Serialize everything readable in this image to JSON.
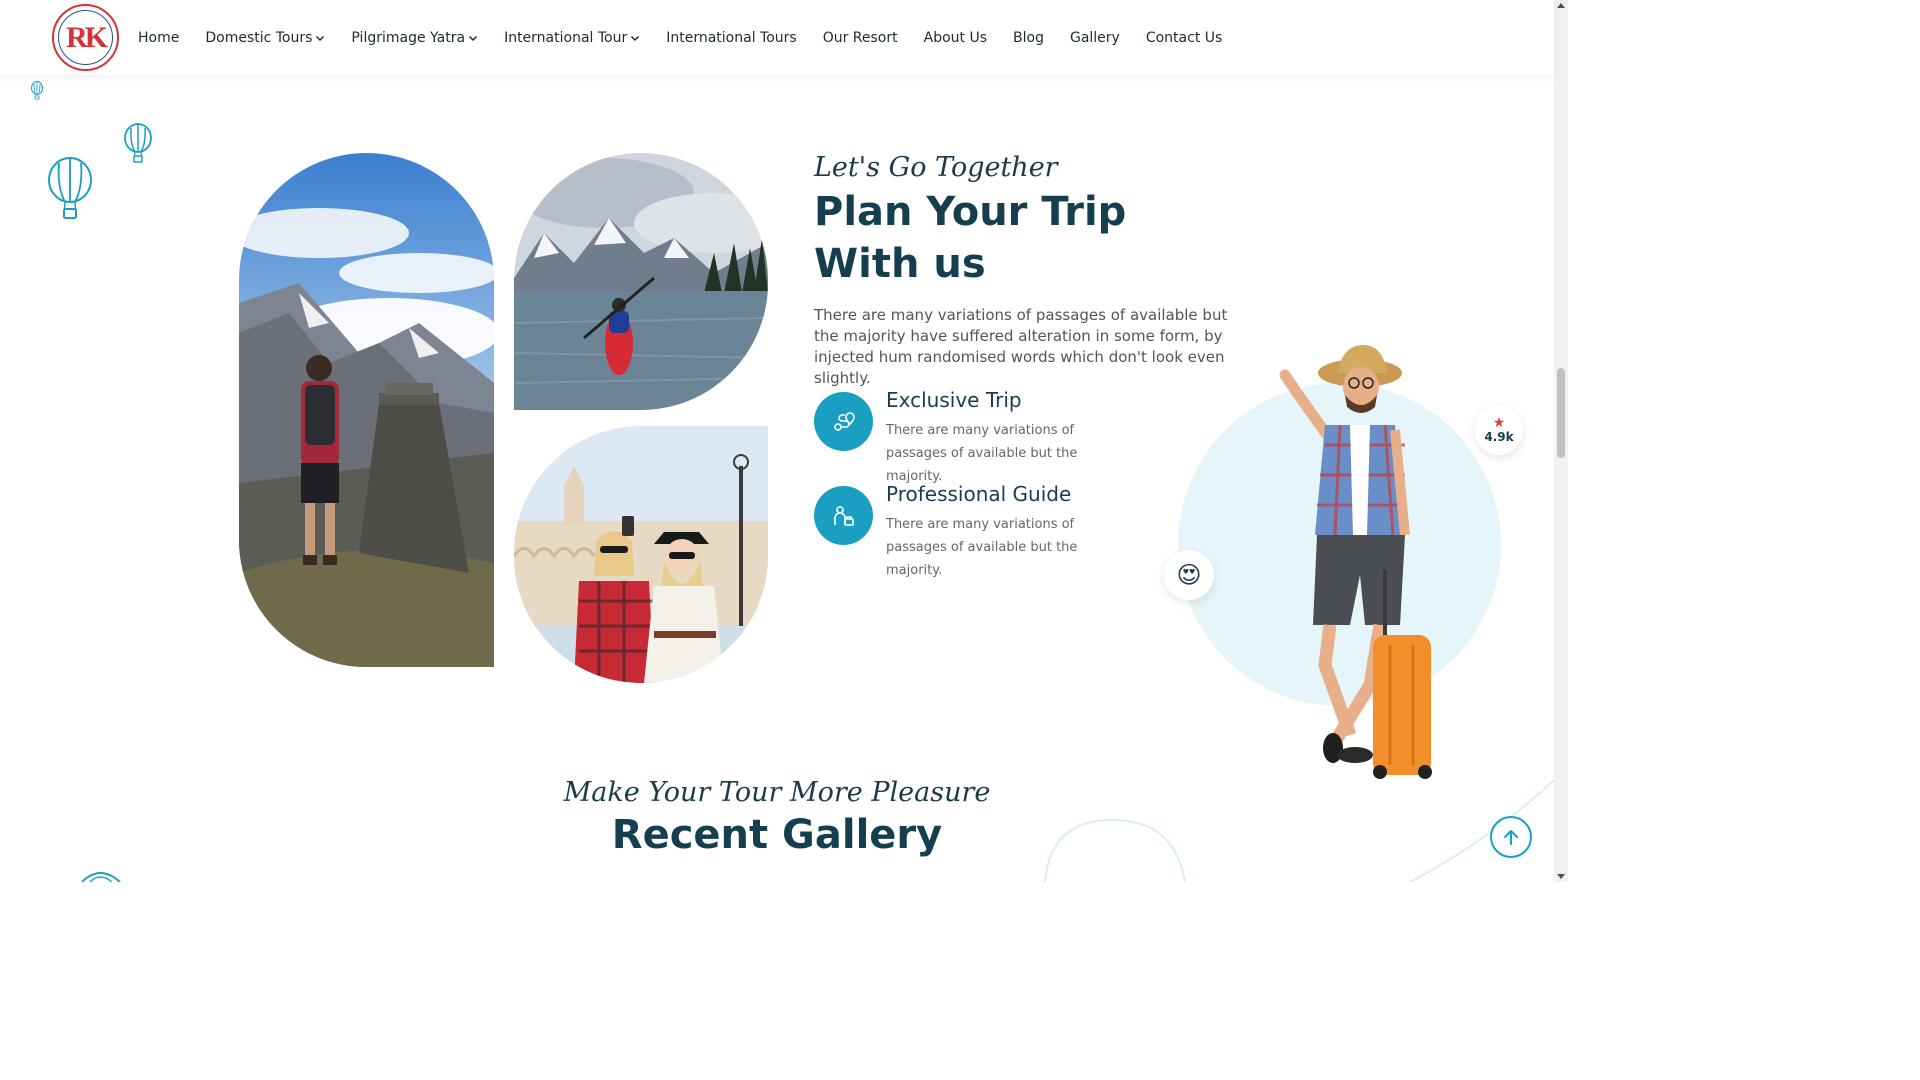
{
  "logo": {
    "text": "RK"
  },
  "nav": {
    "items": [
      {
        "label": "Home",
        "dropdown": false
      },
      {
        "label": "Domestic Tours",
        "dropdown": true
      },
      {
        "label": "Pilgrimage Yatra",
        "dropdown": true
      },
      {
        "label": "International Tour",
        "dropdown": true
      },
      {
        "label": "International Tours",
        "dropdown": false
      },
      {
        "label": "Our Resort",
        "dropdown": false
      },
      {
        "label": "About Us",
        "dropdown": false
      },
      {
        "label": "Blog",
        "dropdown": false
      },
      {
        "label": "Gallery",
        "dropdown": false
      },
      {
        "label": "Contact Us",
        "dropdown": false
      }
    ]
  },
  "about": {
    "subtitle": "Let's Go Together",
    "title_line1": "Plan Your Trip",
    "title_line2": "With us",
    "description": "There are many variations of passages of available but the majority have suffered alteration in some form, by injected hum randomised words which don't look even slightly.",
    "features": [
      {
        "title": "Exclusive Trip",
        "text": "There are many variations of passages of available but the majority.",
        "icon": "route-icon"
      },
      {
        "title": "Professional Guide",
        "text": "There are many variations of passages of available but the majority.",
        "icon": "guide-icon"
      }
    ]
  },
  "rating": {
    "value": "4.9k",
    "icon": "star-icon"
  },
  "emoji": {
    "glyph": "😍"
  },
  "gallery": {
    "subtitle": "Make Your Tour More Pleasure",
    "title": "Recent Gallery"
  },
  "colors": {
    "accent": "#1a9fc2",
    "heading": "#153f4f",
    "logo_red": "#d7323a",
    "circle_bg": "#e6f5fa"
  }
}
